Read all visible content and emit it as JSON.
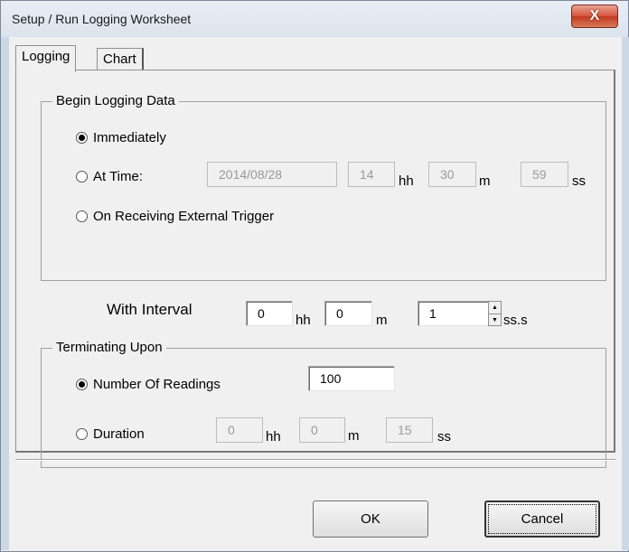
{
  "window": {
    "title": "Setup / Run Logging Worksheet",
    "close_glyph": "X"
  },
  "tabs": [
    {
      "label": "Logging"
    },
    {
      "label": "Chart"
    }
  ],
  "begin": {
    "legend": "Begin Logging Data",
    "options": [
      {
        "label": "Immediately",
        "checked": true
      },
      {
        "label": "At Time:",
        "checked": false
      },
      {
        "label": "On Receiving External Trigger",
        "checked": false
      }
    ],
    "at_time": {
      "date": "2014/08/28",
      "hh": "14",
      "m": "30",
      "ss": "59"
    }
  },
  "interval": {
    "label": "With Interval",
    "hh": "0",
    "m": "0",
    "ss": "1"
  },
  "terminate": {
    "legend": "Terminating Upon",
    "options": [
      {
        "label": "Number Of Readings",
        "checked": true
      },
      {
        "label": "Duration",
        "checked": false
      }
    ],
    "readings": "100",
    "duration": {
      "hh": "0",
      "m": "0",
      "ss": "15"
    }
  },
  "units": {
    "hh": "hh",
    "m": "m",
    "ss": "ss",
    "sss": "ss.s"
  },
  "buttons": {
    "ok": "OK",
    "cancel": "Cancel"
  },
  "spinner": {
    "up": "▲",
    "down": "▼"
  }
}
